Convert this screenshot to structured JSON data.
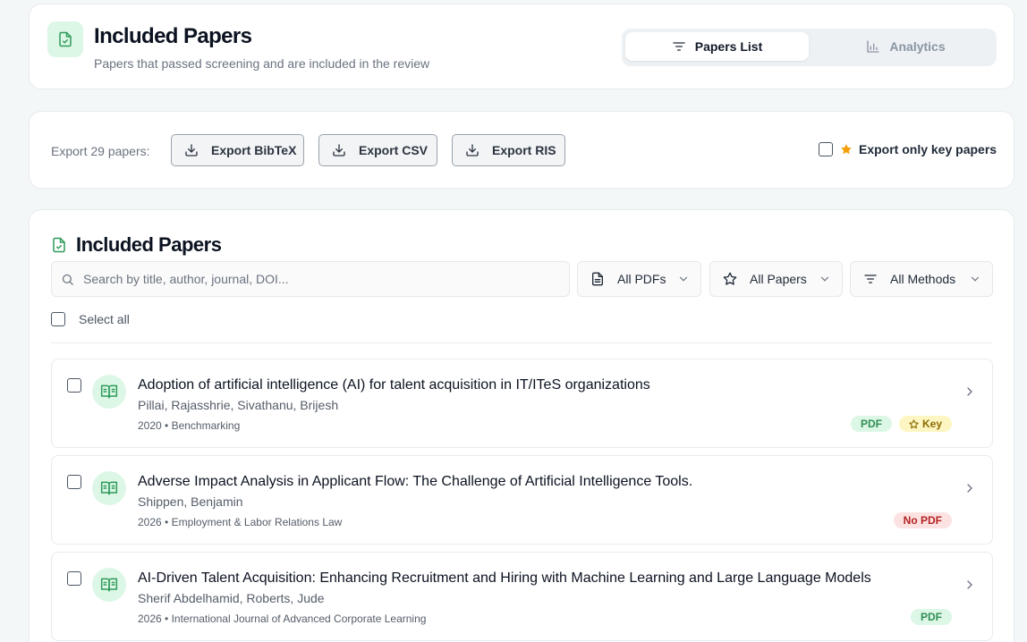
{
  "header": {
    "title": "Included Papers",
    "subtitle": "Papers that passed screening and are included in the review",
    "tabs": [
      {
        "label": "Papers List",
        "icon": "filter-lines-icon",
        "active": true
      },
      {
        "label": "Analytics",
        "icon": "bar-chart-icon",
        "active": false
      }
    ]
  },
  "export": {
    "label": "Export 29 papers:",
    "buttons": [
      {
        "label": "Export BibTeX",
        "icon": "download-icon"
      },
      {
        "label": "Export CSV",
        "icon": "download-icon"
      },
      {
        "label": "Export RIS",
        "icon": "download-icon"
      }
    ],
    "key_only_label": "Export only key papers",
    "key_only_checked": false
  },
  "papers_section": {
    "title": "Included Papers",
    "search_placeholder": "Search by title, author, journal, DOI...",
    "filters": [
      {
        "label": "All PDFs",
        "icon": "file-icon"
      },
      {
        "label": "All Papers",
        "icon": "star-icon"
      },
      {
        "label": "All Methods",
        "icon": "filter-lines-icon"
      }
    ],
    "select_all_label": "Select all",
    "papers": [
      {
        "title": "Adoption of artificial intelligence (AI) for talent acquisition in IT/ITeS organizations",
        "authors": "Pillai, Rajasshrie, Sivathanu, Brijesh",
        "meta": "2020 • Benchmarking",
        "badges": [
          {
            "label": "PDF",
            "type": "pdf"
          },
          {
            "label": "Key",
            "type": "key"
          }
        ]
      },
      {
        "title": "Adverse Impact Analysis in Applicant Flow: The Challenge of Artificial Intelligence Tools.",
        "authors": "Shippen, Benjamin",
        "meta": "2026 • Employment & Labor Relations Law",
        "badges": [
          {
            "label": "No PDF",
            "type": "nopdf"
          }
        ]
      },
      {
        "title": "AI-Driven Talent Acquisition: Enhancing Recruitment and Hiring with Machine Learning and Large Language Models",
        "authors": "Sherif Abdelhamid, Roberts, Jude",
        "meta": "2026 • International Journal of Advanced Corporate Learning",
        "badges": [
          {
            "label": "PDF",
            "type": "pdf"
          }
        ]
      }
    ]
  },
  "colors": {
    "accent_green": "#2f8f55",
    "accent_green_bg": "#dcf7e6",
    "key_star": "#f59e0b",
    "no_pdf_red": "#b42323"
  }
}
